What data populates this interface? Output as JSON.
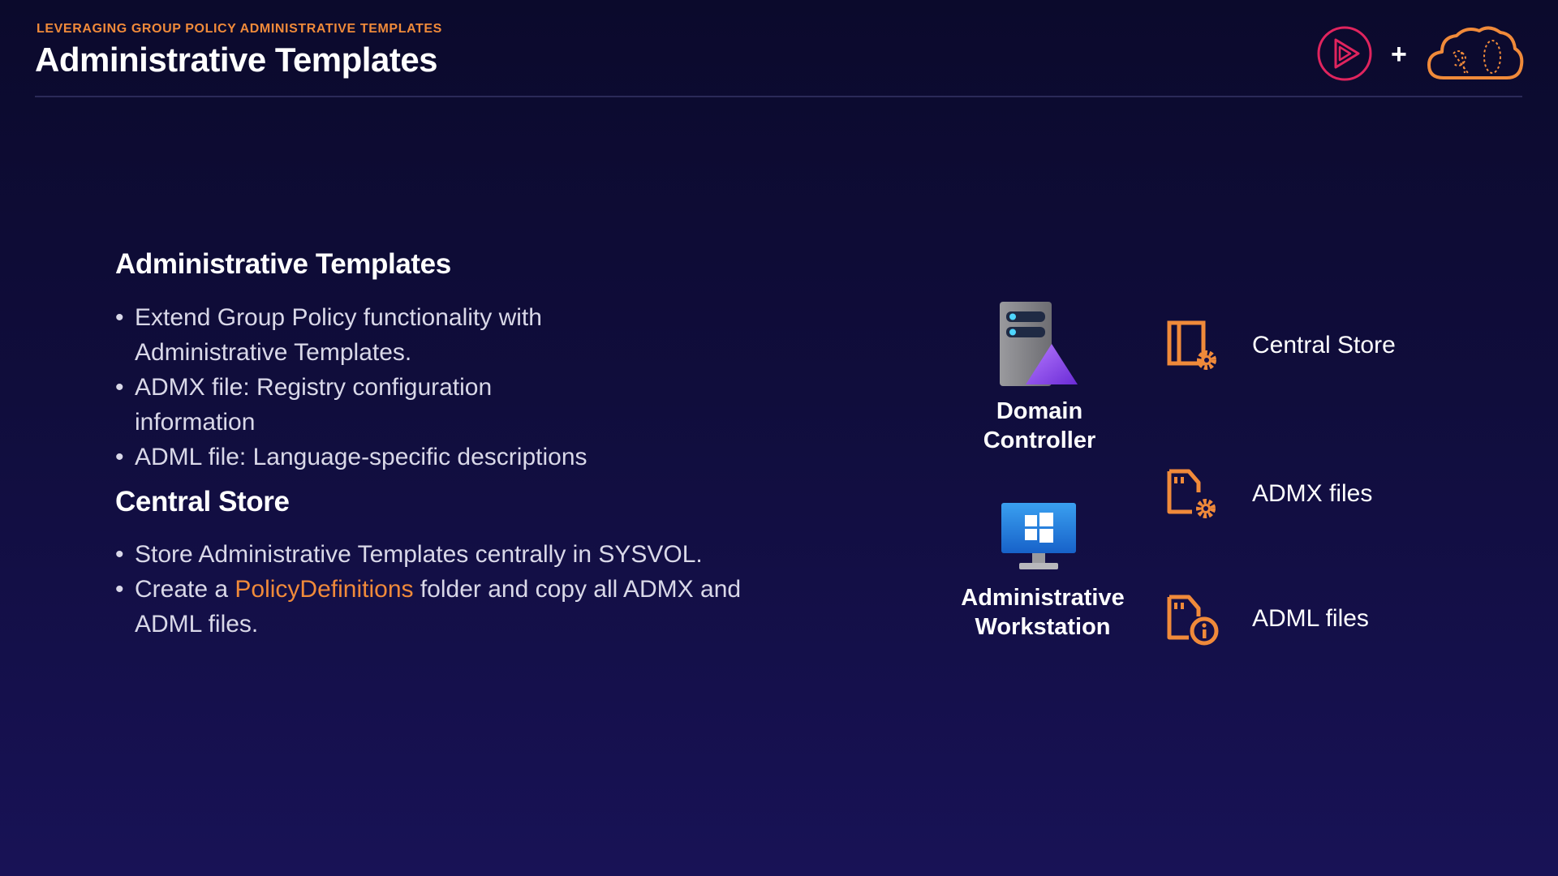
{
  "header": {
    "kicker": "LEVERAGING GROUP POLICY ADMINISTRATIVE TEMPLATES",
    "title": "Administrative Templates",
    "plus": "+",
    "accent_color": "#f08a3a",
    "brand_color": "#e0245e"
  },
  "sections": [
    {
      "title": "Administrative Templates",
      "bullets": [
        "Extend Group Policy functionality with Administrative Templates.",
        "ADMX file: Registry configuration information",
        "ADML file: Language-specific descriptions"
      ]
    },
    {
      "title": "Central Store",
      "bullets": [
        "Store Administrative Templates centrally in SYSVOL.",
        {
          "prefix": "Create a ",
          "highlight": "PolicyDefinitions",
          "suffix": " folder and copy all ADMX and ADML files."
        }
      ]
    }
  ],
  "diagram": {
    "domain_controller": {
      "line1": "Domain",
      "line2": "Controller",
      "icon": "server-icon"
    },
    "workstation": {
      "line1": "Administrative",
      "line2": "Workstation",
      "icon": "windows-monitor-icon"
    },
    "legend": [
      {
        "label": "Central Store",
        "icon": "folder-gear-icon"
      },
      {
        "label": "ADMX files",
        "icon": "file-gear-icon"
      },
      {
        "label": "ADML files",
        "icon": "file-info-icon"
      }
    ]
  }
}
